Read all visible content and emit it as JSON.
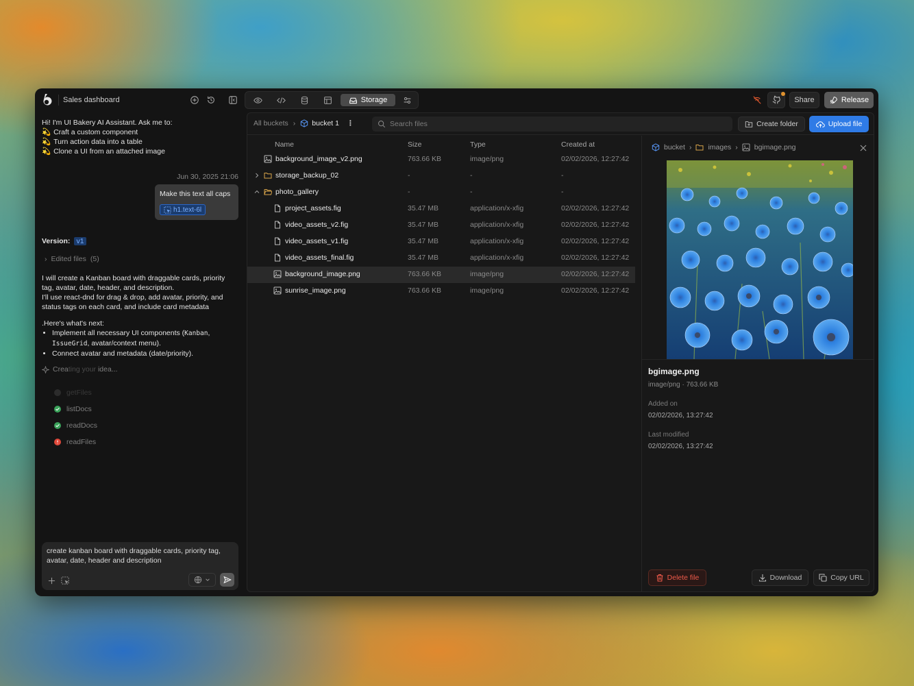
{
  "app": {
    "title": "Sales dashboard",
    "modes": [
      "preview",
      "code",
      "database",
      "layout",
      "storage",
      "settings"
    ],
    "active_mode_label": "Storage",
    "share_label": "Share",
    "release_label": "Release"
  },
  "chat": {
    "intro_line": "Hi! I'm UI Bakery AI Assistant. Ask me to:",
    "intro_bullets": [
      "Craft a custom component",
      "Turn action data into a table",
      "Clone a UI from an attached image"
    ],
    "message_date": "Jun 30, 2025 21:06",
    "user_message": "Make this text all caps",
    "user_chip": "h1.text-6l",
    "version_label": "Version:",
    "version_tag": "v1",
    "edited_files_label": "Edited files",
    "edited_files_count": "(5)",
    "reply_p1": "I will create a Kanban board with draggable cards, priority tag, avatar, date, header, and description.",
    "reply_p2": "I'll use react-dnd for drag & drop, add avatar, priority, and status tags on each card, and include card metadata",
    "next_heading": ".Here's what's next:",
    "next_b1_pre": "Implement all necessary UI components (",
    "next_b1_code1": "Kanban",
    "next_b1_sep": ", ",
    "next_b1_code2": "IssueGrid",
    "next_b1_post": ", avatar/context menu).",
    "next_b2": "Connect avatar and metadata (date/priority).",
    "creating_a": "Crea",
    "creating_b": "ting your ",
    "creating_c": "idea...",
    "steps": [
      {
        "label": "getFiles",
        "status": "pending"
      },
      {
        "label": "listDocs",
        "status": "done"
      },
      {
        "label": "readDocs",
        "status": "done"
      },
      {
        "label": "readFiles",
        "status": "error"
      }
    ],
    "composer_text": "create kanban board with draggable cards, priority tag, avatar, date, header and description"
  },
  "storage": {
    "breadcrumb_root": "All buckets",
    "breadcrumb_bucket": "bucket 1",
    "search_placeholder": "Search files",
    "create_folder_label": "Create folder",
    "upload_label": "Upload file",
    "columns": {
      "name": "Name",
      "size": "Size",
      "type": "Type",
      "created": "Created at"
    },
    "rows": [
      {
        "name": "background_image_v2.png",
        "size": "763.66 KB",
        "type": "image/png",
        "created": "02/02/2026, 12:27:42"
      },
      {
        "name": "storage_backup_02",
        "size": "-",
        "type": "-",
        "created": "-"
      },
      {
        "name": "photo_gallery",
        "size": "-",
        "type": "-",
        "created": "-"
      },
      {
        "name": "project_assets.fig",
        "size": "35.47 MB",
        "type": "application/x-xfig",
        "created": "02/02/2026, 12:27:42"
      },
      {
        "name": "video_assets_v2.fig",
        "size": "35.47 MB",
        "type": "application/x-xfig",
        "created": "02/02/2026, 12:27:42"
      },
      {
        "name": "video_assets_v1.fig",
        "size": "35.47 MB",
        "type": "application/x-xfig",
        "created": "02/02/2026, 12:27:42"
      },
      {
        "name": "video_assets_final.fig",
        "size": "35.47 MB",
        "type": "application/x-xfig",
        "created": "02/02/2026, 12:27:42"
      },
      {
        "name": "background_image.png",
        "size": "763.66 KB",
        "type": "image/png",
        "created": "02/02/2026, 12:27:42"
      },
      {
        "name": "sunrise_image.png",
        "size": "763.66 KB",
        "type": "image/png",
        "created": "02/02/2026, 12:27:42"
      }
    ]
  },
  "detail": {
    "crumb_bucket": "bucket",
    "crumb_folder": "images",
    "crumb_file": "bgimage.png",
    "file_name": "bgimage.png",
    "file_meta": "image/png · 763.66 KB",
    "added_label": "Added on",
    "added_value": "02/02/2026, 13:27:42",
    "modified_label": "Last modified",
    "modified_value": "02/02/2026, 13:27:42",
    "delete_label": "Delete file",
    "download_label": "Download",
    "copy_url_label": "Copy URL"
  },
  "colors": {
    "accent": "#2f7be6",
    "danger": "#ef5a4a",
    "success": "#3aa35a",
    "folder": "#d9a54a"
  }
}
